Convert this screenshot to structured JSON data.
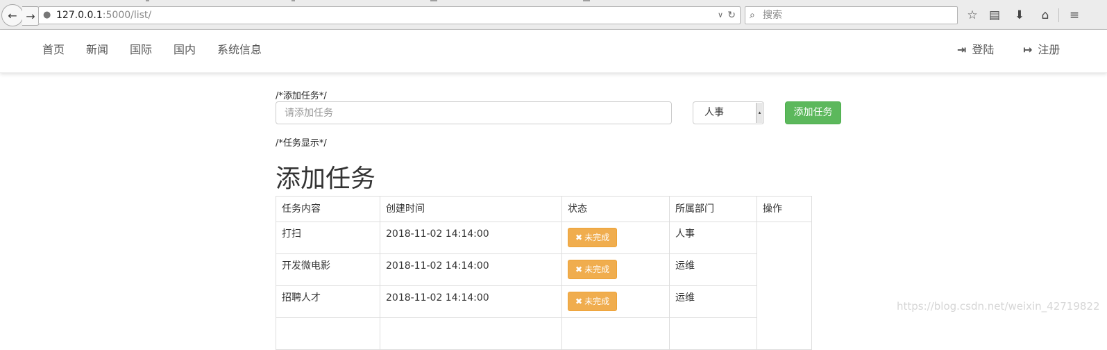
{
  "browser": {
    "url_host": "127.0.0.1",
    "url_path": ":5000/list/",
    "search_placeholder": "搜索"
  },
  "navbar": {
    "left_items": [
      "首页",
      "新闻",
      "国际",
      "国内",
      "系统信息"
    ],
    "login_label": "登陆",
    "register_label": "注册"
  },
  "form": {
    "comment_add": "/*添加任务*/",
    "input_placeholder": "请添加任务",
    "dept_selected": "人事",
    "add_button": "添加任务"
  },
  "list": {
    "comment_show": "/*任务显示*/",
    "heading": "添加任务",
    "columns": [
      "任务内容",
      "创建时间",
      "状态",
      "所属部门",
      "操作"
    ],
    "rows": [
      {
        "content": "打扫",
        "created": "2018-11-02 14:14:00",
        "status": "未完成",
        "dept": "人事"
      },
      {
        "content": "开发微电影",
        "created": "2018-11-02 14:14:00",
        "status": "未完成",
        "dept": "运维"
      },
      {
        "content": "招聘人才",
        "created": "2018-11-02 14:14:00",
        "status": "未完成",
        "dept": "运维"
      }
    ]
  },
  "watermark": "https://blog.csdn.net/weixin_42719822",
  "colors": {
    "success": "#5cb85c",
    "warning": "#f0ad4e"
  }
}
